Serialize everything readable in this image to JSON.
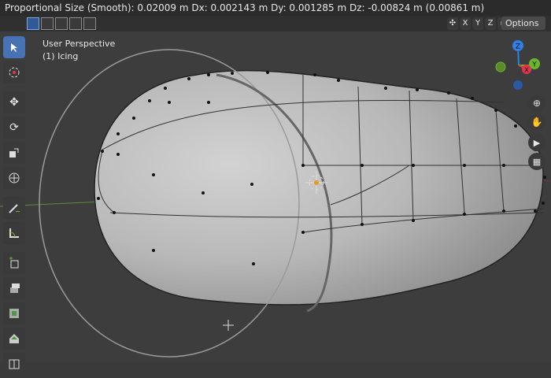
{
  "status_bar": {
    "text": "Proportional Size (Smooth): 0.02009 m   Dx: 0.002143 m   Dy: 0.001285 m   Dz: -0.00824 m (0.00861 m)"
  },
  "header": {
    "axis_labels": [
      "X",
      "Y",
      "Z"
    ],
    "options_label": "Options"
  },
  "viewport": {
    "view_name": "User Perspective",
    "object_label": "(1) Icing"
  },
  "gizmo": {
    "z_label": "Z",
    "y_label": "Y",
    "x_label": "X"
  },
  "icons": {
    "tools": [
      "select-box-icon",
      "cursor-icon",
      "move-icon",
      "rotate-icon",
      "scale-icon",
      "transform-icon",
      "annotate-icon",
      "measure-icon",
      "add-cube-icon",
      "extrude-icon",
      "inset-icon",
      "bevel-icon",
      "loop-cut-icon"
    ],
    "nav": [
      "zoom-icon",
      "hand-pan-icon",
      "camera-icon",
      "grid-icon"
    ]
  },
  "colors": {
    "active_tool": "#4772b3",
    "axis_x": "#e3344f",
    "axis_y": "#6ab62b",
    "axis_z": "#2f7fe6"
  }
}
